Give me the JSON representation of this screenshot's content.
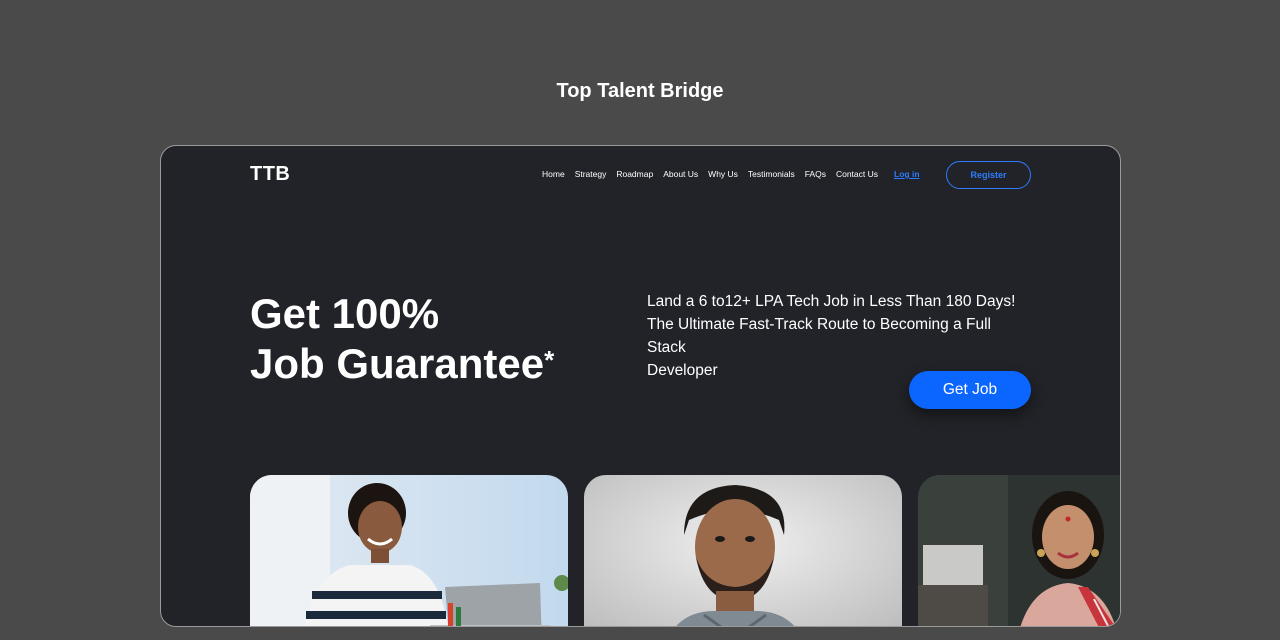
{
  "page": {
    "heading": "Top Talent Bridge"
  },
  "header": {
    "logo": "TTB",
    "nav_items": [
      "Home",
      "Strategy",
      "Roadmap",
      "About Us",
      "Why Us",
      "Testimonials",
      "FAQs",
      "Contact Us"
    ],
    "login_label": "Log in",
    "register_label": "Register"
  },
  "hero": {
    "title_line1": "Get 100%",
    "title_line2": "Job Guarantee",
    "title_mark": "*",
    "description_line1": "Land a 6 to12+ LPA Tech Job in Less Than 180 Days!",
    "description_line2": "The Ultimate Fast-Track Route to Becoming a Full Stack",
    "description_line3": "Developer",
    "cta_label": "Get Job"
  },
  "colors": {
    "page_background": "#4a4a4a",
    "frame_background": "#212328",
    "accent": "#0b66ff",
    "link": "#2f7bff"
  }
}
